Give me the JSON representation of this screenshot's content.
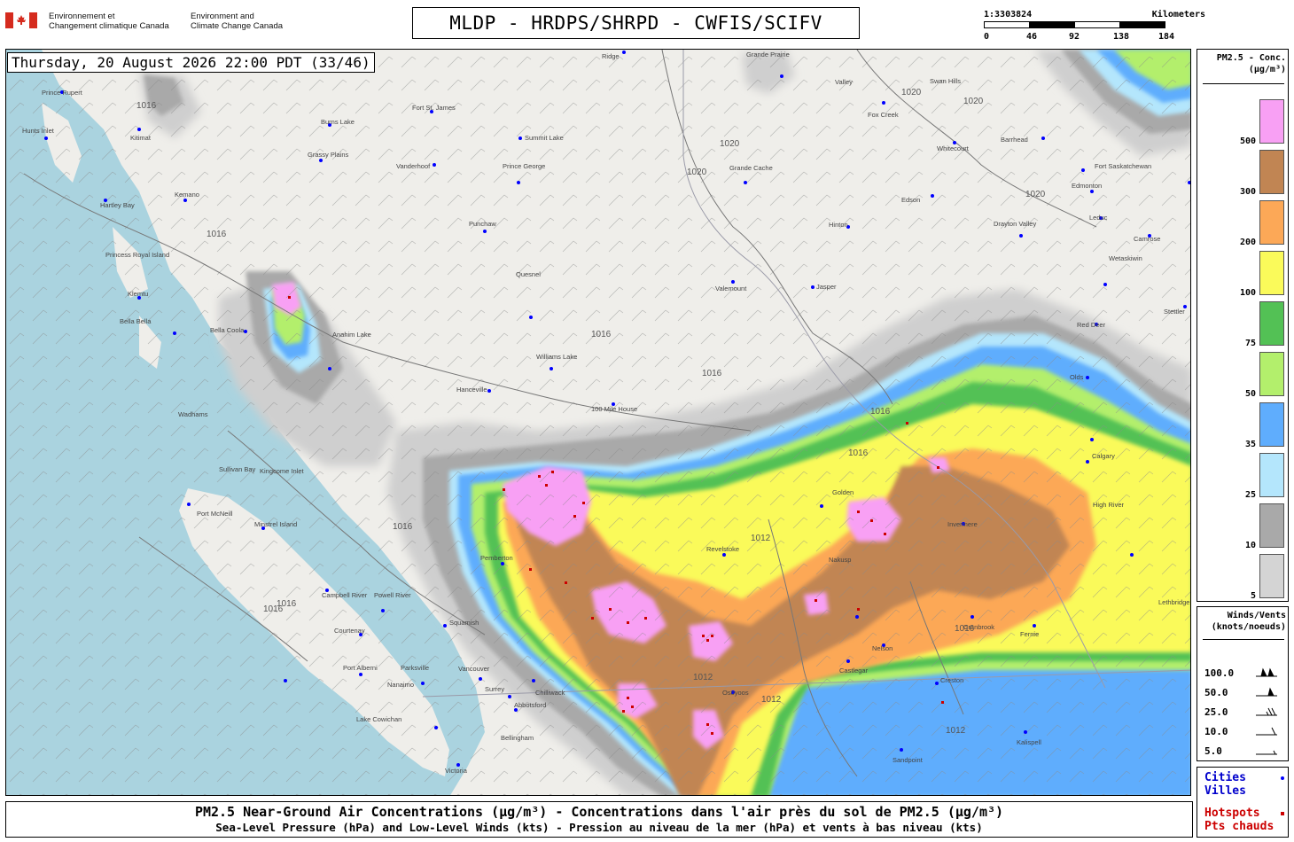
{
  "header": {
    "dept_fr_1": "Environnement et",
    "dept_fr_2": "Changement climatique Canada",
    "dept_en_1": "Environment and",
    "dept_en_2": "Climate Change Canada",
    "title": "MLDP - HRDPS/SHRPD - CWFIS/SCIFV"
  },
  "scale": {
    "ratio": "1:3303824",
    "unit": "Kilometers",
    "ticks": [
      "0",
      "46",
      "92",
      "138",
      "184"
    ]
  },
  "map": {
    "timestamp": "Thursday, 20 August 2026 22:00 PDT (33/46)",
    "isobar_labels": [
      "1020",
      "1020",
      "1020",
      "1020",
      "1020",
      "1016",
      "1016",
      "1016",
      "1016",
      "1016",
      "1016",
      "1012",
      "1012",
      "1012",
      "1016",
      "1016",
      "1016",
      "1012",
      "1016"
    ],
    "cities": [
      "Prince Rupert",
      "Hunts Inlet",
      "Kitimat",
      "Hartley Bay",
      "Kemano",
      "Princess Royal Island",
      "Klemtu",
      "Bella Bella",
      "Bella Coola",
      "Anahim Lake",
      "Wadhams",
      "Sullivan Bay",
      "Kingcome Inlet",
      "Port McNeill",
      "Minstrel Island",
      "Campbell River",
      "Powell River",
      "Courtenay",
      "Port Alberni",
      "Parksville",
      "Nanaimo",
      "Lake Cowichan",
      "Victoria",
      "Vancouver",
      "Surrey",
      "Abbotsford",
      "Chilliwack",
      "Bellingham",
      "Squamish",
      "Pemberton",
      "Burns Lake",
      "Grassy Plains",
      "Fort St. James",
      "Vanderhoof",
      "Summit Lake",
      "Prince George",
      "Punchaw",
      "Quesnel",
      "Williams Lake",
      "Hanceville",
      "100 Mile House",
      "Grande Cache",
      "Valemount",
      "Jasper",
      "Hinton",
      "Edson",
      "Grande Prairie",
      "Fox Creek",
      "Swan Hills",
      "Whitecourt",
      "Barrhead",
      "Fort Saskatchewan",
      "Edmonton",
      "Leduc",
      "Drayton Valley",
      "Camrose",
      "Wetaskiwin",
      "Red Deer",
      "Stettler",
      "Olds",
      "Calgary",
      "High River",
      "Invermere",
      "Nakusp",
      "Nelson",
      "Castlegar",
      "Osoyoos",
      "Cranbrook",
      "Fernie",
      "Creston",
      "Lethbridge",
      "Sandpoint",
      "Kalispell",
      "Revelstoke",
      "Golden",
      "Valley",
      "Ridge"
    ]
  },
  "legend": {
    "title_1": "PM2.5 - Conc.",
    "title_2": "(µg/m³)",
    "bins": [
      {
        "label": "500",
        "color": "#f8a0f4"
      },
      {
        "label": "300",
        "color": "#c18553"
      },
      {
        "label": "200",
        "color": "#fca857"
      },
      {
        "label": "100",
        "color": "#fafa5a"
      },
      {
        "label": "75",
        "color": "#53c155"
      },
      {
        "label": "50",
        "color": "#b3ef6c"
      },
      {
        "label": "35",
        "color": "#5fadfd"
      },
      {
        "label": "25",
        "color": "#b4e6fc"
      },
      {
        "label": "10",
        "color": "#a9a9a9"
      },
      {
        "label": "5",
        "color": "#d4d4d4"
      }
    ]
  },
  "wind_legend": {
    "title_1": "Winds/Vents",
    "title_2": "(knots/noeuds)",
    "rows": [
      "100.0",
      "50.0",
      "25.0",
      "10.0",
      "5.0"
    ]
  },
  "symbols": {
    "cities_en": "Cities",
    "cities_fr": "Villes",
    "hotspots_en": "Hotspots",
    "hotspots_fr": "Pts chauds",
    "city_color": "#0000ff",
    "hotspot_color": "#cc0000"
  },
  "footer": {
    "line1": "PM2.5 Near-Ground Air Concentrations (µg/m³) - Concentrations dans l'air près du sol de PM2.5 (µg/m³)",
    "line2": "Sea-Level Pressure (hPa) and Low-Level Winds (kts) - Pression au niveau de la mer (hPa) et vents à bas niveau (kts)"
  }
}
